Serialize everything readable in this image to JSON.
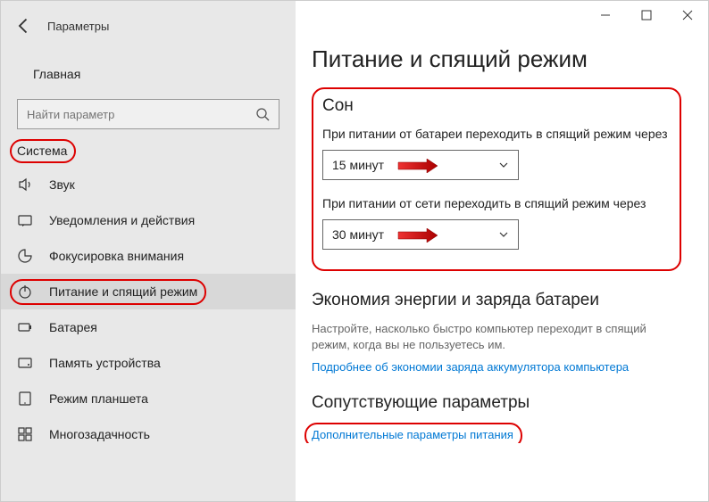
{
  "app_title": "Параметры",
  "home_label": "Главная",
  "search_placeholder": "Найти параметр",
  "category": "Система",
  "nav": [
    {
      "icon": "sound",
      "label": "Звук"
    },
    {
      "icon": "notifications",
      "label": "Уведомления и действия"
    },
    {
      "icon": "focus",
      "label": "Фокусировка внимания"
    },
    {
      "icon": "power",
      "label": "Питание и спящий режим"
    },
    {
      "icon": "battery",
      "label": "Батарея"
    },
    {
      "icon": "storage",
      "label": "Память устройства"
    },
    {
      "icon": "tablet",
      "label": "Режим планшета"
    },
    {
      "icon": "multitask",
      "label": "Многозадачность"
    }
  ],
  "page_title": "Питание и спящий режим",
  "sleep": {
    "heading": "Сон",
    "battery_label": "При питании от батареи переходить в спящий режим через",
    "battery_value": "15 минут",
    "plugged_label": "При питании от сети переходить в спящий режим через",
    "plugged_value": "30 минут"
  },
  "economy": {
    "heading": "Экономия энергии и заряда батареи",
    "desc": "Настройте, насколько быстро компьютер переходит в спящий режим, когда вы не пользуетесь им.",
    "link": "Подробнее об экономии заряда аккумулятора компьютера"
  },
  "related": {
    "heading": "Сопутствующие параметры",
    "link": "Дополнительные параметры питания"
  }
}
